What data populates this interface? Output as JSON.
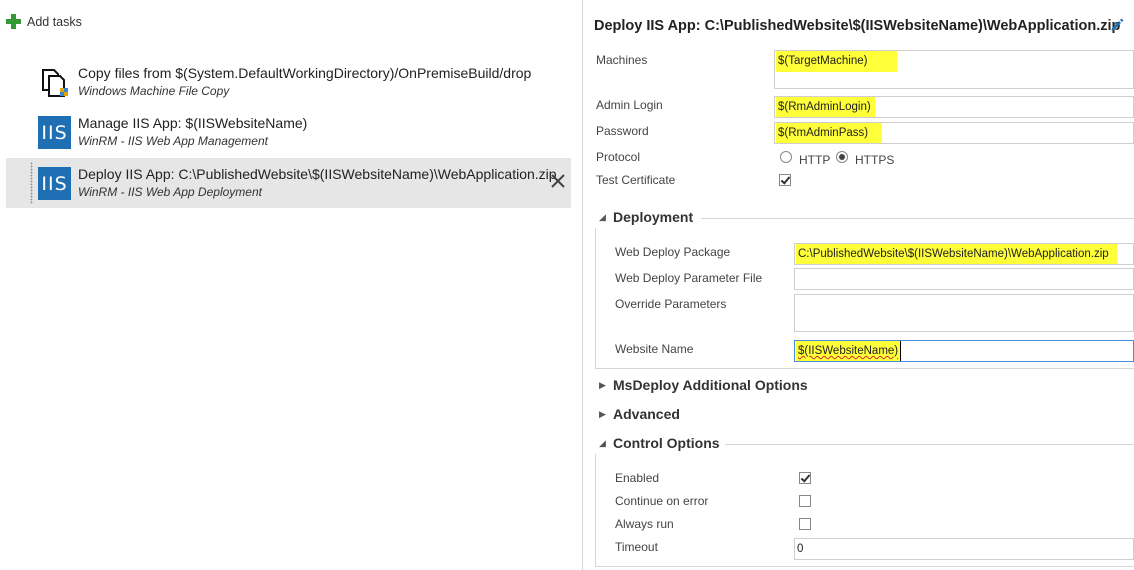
{
  "left": {
    "add_tasks_label": "Add tasks",
    "tasks": [
      {
        "title": "Copy files from $(System.DefaultWorkingDirectory)/OnPremiseBuild/drop",
        "subtitle": "Windows Machine File Copy",
        "icon": "file-copy-icon"
      },
      {
        "title": "Manage IIS App: $(IISWebsiteName)",
        "subtitle": "WinRM - IIS Web App Management",
        "icon": "iis-icon",
        "icon_text": "IIS"
      },
      {
        "title": "Deploy IIS App: C:\\PublishedWebsite\\$(IISWebsiteName)\\WebApplication.zip",
        "subtitle": "WinRM - IIS Web App Deployment",
        "icon": "iis-icon",
        "icon_text": "IIS",
        "selected": true
      }
    ]
  },
  "detail": {
    "title": "Deploy IIS App: C:\\PublishedWebsite\\$(IISWebsiteName)\\WebApplication.zip",
    "machines": {
      "label": "Machines",
      "value": "$(TargetMachine)"
    },
    "admin_login": {
      "label": "Admin Login",
      "value": "$(RmAdminLogin)"
    },
    "password": {
      "label": "Password",
      "value": "$(RmAdminPass)"
    },
    "protocol": {
      "label": "Protocol",
      "options": [
        "HTTP",
        "HTTPS"
      ],
      "selected": "HTTPS"
    },
    "test_certificate": {
      "label": "Test Certificate",
      "checked": true
    },
    "deployment": {
      "title": "Deployment",
      "web_deploy_package": {
        "label": "Web Deploy Package",
        "value": "C:\\PublishedWebsite\\$(IISWebsiteName)\\WebApplication.zip"
      },
      "web_deploy_parameter_file": {
        "label": "Web Deploy Parameter File",
        "value": ""
      },
      "override_parameters": {
        "label": "Override Parameters",
        "value": ""
      },
      "website_name": {
        "label": "Website Name",
        "value": "$(IISWebsiteName)"
      }
    },
    "msdeploy_section": "MsDeploy Additional Options",
    "advanced_section": "Advanced",
    "control_options": {
      "title": "Control Options",
      "enabled": {
        "label": "Enabled",
        "checked": true
      },
      "continue_on_error": {
        "label": "Continue on error",
        "checked": false
      },
      "always_run": {
        "label": "Always run",
        "checked": false
      },
      "timeout": {
        "label": "Timeout",
        "value": "0"
      }
    }
  },
  "colors": {
    "highlight": "#ffff3a",
    "iis_blue": "#1f6fb5",
    "plus_green": "#339933",
    "selected_row": "#e6e6e6"
  }
}
